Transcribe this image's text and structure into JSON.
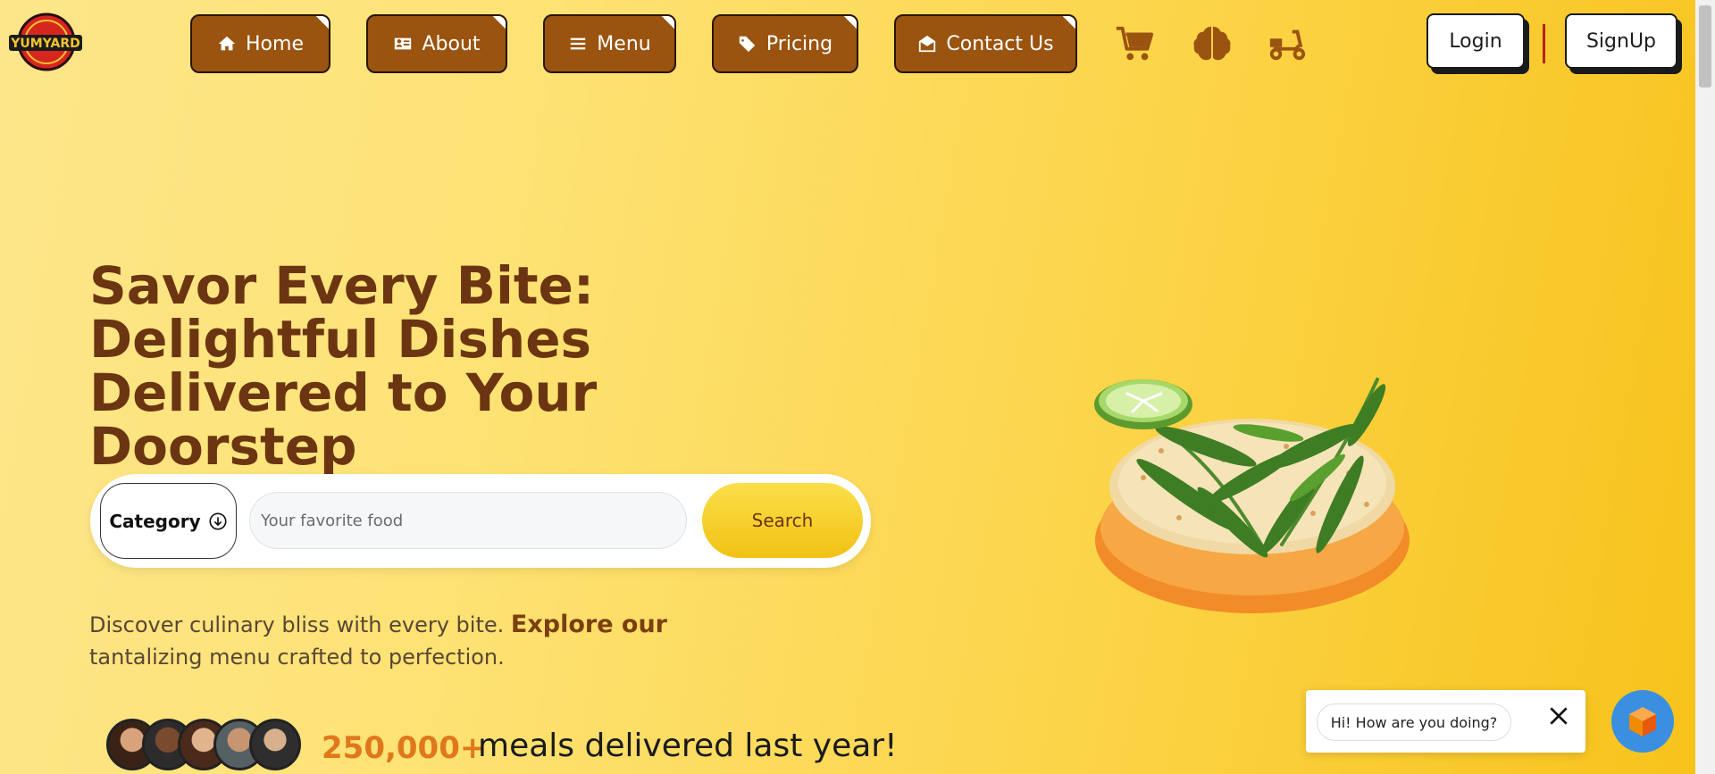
{
  "brand": {
    "logo_text": "YUMYARD"
  },
  "nav": {
    "items": [
      {
        "label": "Home",
        "icon": "home-icon"
      },
      {
        "label": "About",
        "icon": "id-card-icon"
      },
      {
        "label": "Menu",
        "icon": "hamburger-icon"
      },
      {
        "label": "Pricing",
        "icon": "tags-icon"
      },
      {
        "label": "Contact Us",
        "icon": "envelope-open-icon"
      }
    ],
    "extra_icons": [
      "cart-icon",
      "brain-icon",
      "scooter-icon"
    ],
    "login_label": "Login",
    "signup_label": "SignUp"
  },
  "hero": {
    "title": "Savor Every Bite: Delightful Dishes Delivered to Your Doorstep",
    "tagline_before": "Discover culinary bliss with every bite. ",
    "tagline_highlight": "Explore our",
    "tagline_after": " tantalizing menu crafted to perfection."
  },
  "search": {
    "category_label": "Category",
    "placeholder": "Your favorite food",
    "button_label": "Search"
  },
  "stats": {
    "count": "250,000+",
    "text": "meals delivered last year!"
  },
  "chat": {
    "greeting": "Hi! How are you doing?"
  },
  "colors": {
    "nav_button": "#9a5410",
    "title": "#6b3512",
    "stat_number": "#e0781b",
    "search_button": "#f2c214"
  }
}
